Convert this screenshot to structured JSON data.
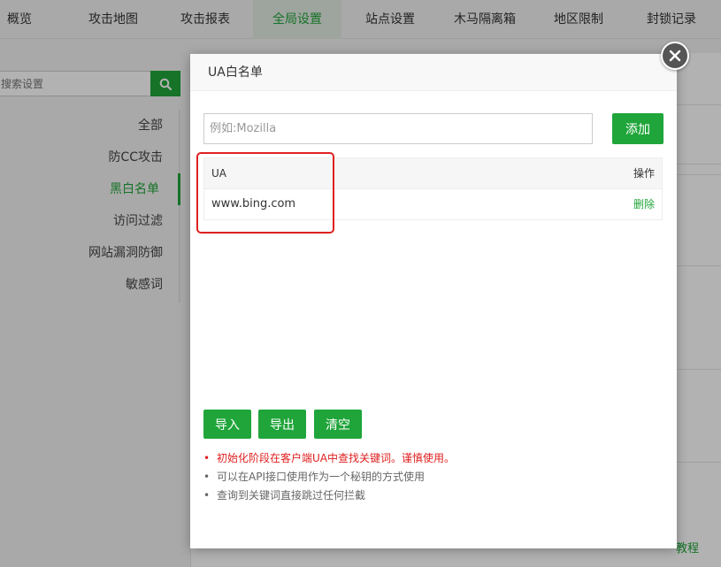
{
  "topnav": {
    "tabs": [
      {
        "label": "概览"
      },
      {
        "label": "攻击地图"
      },
      {
        "label": "攻击报表"
      },
      {
        "label": "全局设置"
      },
      {
        "label": "站点设置"
      },
      {
        "label": "木马隔离箱"
      },
      {
        "label": "地区限制"
      },
      {
        "label": "封锁记录"
      }
    ],
    "active": "全局设置"
  },
  "sidebar": {
    "search_placeholder": "搜索设置",
    "items": [
      {
        "label": "全部"
      },
      {
        "label": "防CC攻击"
      },
      {
        "label": "黑白名单"
      },
      {
        "label": "访问过滤"
      },
      {
        "label": "网站漏洞防御"
      },
      {
        "label": "敏感词"
      }
    ],
    "active": "黑白名单"
  },
  "background": {
    "link_text": "教程"
  },
  "modal": {
    "title": "UA白名单",
    "input_placeholder": "例如:Mozilla",
    "add_label": "添加",
    "table": {
      "headers": {
        "ua": "UA",
        "op": "操作"
      },
      "rows": [
        {
          "ua": "www.bing.com",
          "op": "删除"
        }
      ]
    },
    "actions": {
      "import": "导入",
      "export": "导出",
      "clear": "清空"
    },
    "tips": [
      {
        "text": "初始化阶段在客户端UA中查找关键词。谨慎使用。",
        "warn": true
      },
      {
        "text": "可以在API接口使用作为一个秘钥的方式使用",
        "warn": false
      },
      {
        "text": "查询到关键词直接跳过任何拦截",
        "warn": false
      }
    ]
  },
  "colors": {
    "accent": "#20a53a",
    "warning": "#e02020",
    "highlight_box": "#e02020"
  }
}
